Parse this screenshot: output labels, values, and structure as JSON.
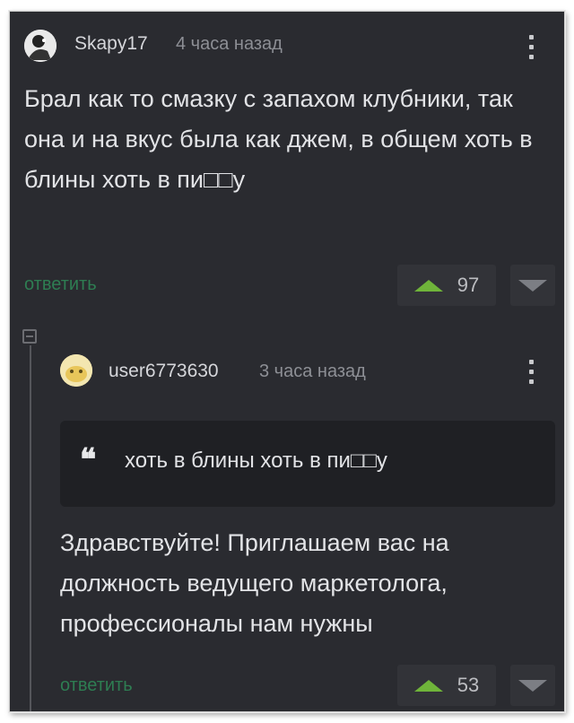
{
  "comment": {
    "username": "Skapy17",
    "time": "4 часа назад",
    "text": "Брал как то смазку с запахом клубники, так она и на вкус была как джем, в общем хоть в блины хоть в пи□□у",
    "reply_label": "ответить",
    "score": "97"
  },
  "reply": {
    "username": "user6773630",
    "time": "3 часа назад",
    "quote_text": "хоть в блины хоть в пи□□у",
    "text": "Здравствуйте!  Приглашаем вас на должность ведущего маркетолога, профессионалы нам нужны",
    "reply_label": "ответить",
    "score": "53"
  },
  "colors": {
    "background": "#2a2b30",
    "reply_link": "#2e7d52",
    "upvote": "#6fb43a",
    "downvote": "#7c7e84"
  },
  "icons": [
    "user-avatar-icon",
    "kebab-menu-icon",
    "upvote-icon",
    "downvote-icon",
    "collapse-thread-icon",
    "quote-icon"
  ]
}
